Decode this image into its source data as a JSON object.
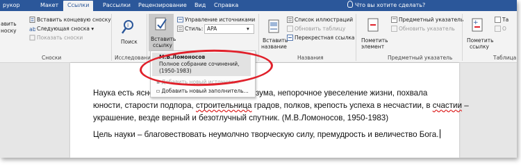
{
  "tabs": [
    "рукор",
    "Макет",
    "Ссылки",
    "Рассылки",
    "Рецензирование",
    "Вид",
    "Справка"
  ],
  "active_tab": "Ссылки",
  "tell_me": "Что вы хотите сделать?",
  "ribbon": {
    "footnotes": {
      "insert_endnote": "Вставить концевую сноску",
      "next_footnote": "Следующая сноска",
      "show_notes": "Показать сноски",
      "insert_footnote_partial": [
        "авить",
        "носку"
      ],
      "group": "Сноски"
    },
    "research": {
      "search": "Поиск",
      "group": "Исследование"
    },
    "citations": {
      "insert_citation": [
        "Вставить",
        "ссылку"
      ],
      "manage_sources": "Управление источниками",
      "style_label": "Стиль:",
      "style_value": "APA"
    },
    "captions": {
      "insert_caption": [
        "Вставить",
        "название"
      ],
      "list_of_figures": "Список иллюстраций",
      "update_table": "Обновить таблицу",
      "cross_reference": "Перекрестная ссылка",
      "group": "Названия"
    },
    "index": {
      "mark_entry": [
        "Пометить",
        "элемент"
      ],
      "insert_index": "Предметный указатель",
      "update_index": "Обновить указатель",
      "group": "Предметный указатель"
    },
    "toa": {
      "mark_citation": [
        "Пометить",
        "ссылку"
      ],
      "insert_partial": "Та",
      "update_partial": "О",
      "group": "Таблица"
    }
  },
  "dropdown": {
    "source_author": "М.В.Ломоносов",
    "source_title": "Полное собрание сочинений,",
    "source_year": "(1950-1983)",
    "add_source": "Добавить новый источник...",
    "add_placeholder": "Добавить новый заполнитель..."
  },
  "document": {
    "line1_visible": "Наука есть ясно",
    "line1_end": "ение разума, непорочное увеселение жизни, похвала",
    "line2_a": "юности, старости подпора, ",
    "line2_sq": "строительница",
    "line2_b": " градов, полков, крепость успеха в несчастии, в ",
    "line2_sq2": "счастии",
    "line2_c": " –",
    "line3": "украшение, везде верный и безотлучный спутник. (М.В.Ломоносов, 1950-1983)",
    "line4": "Цель науки – благовествовать неумолчно творческую силу, премудрость и величество Бога."
  },
  "colors": {
    "ribbon_blue": "#2b579a",
    "highlight_ring": "#e0202a"
  }
}
